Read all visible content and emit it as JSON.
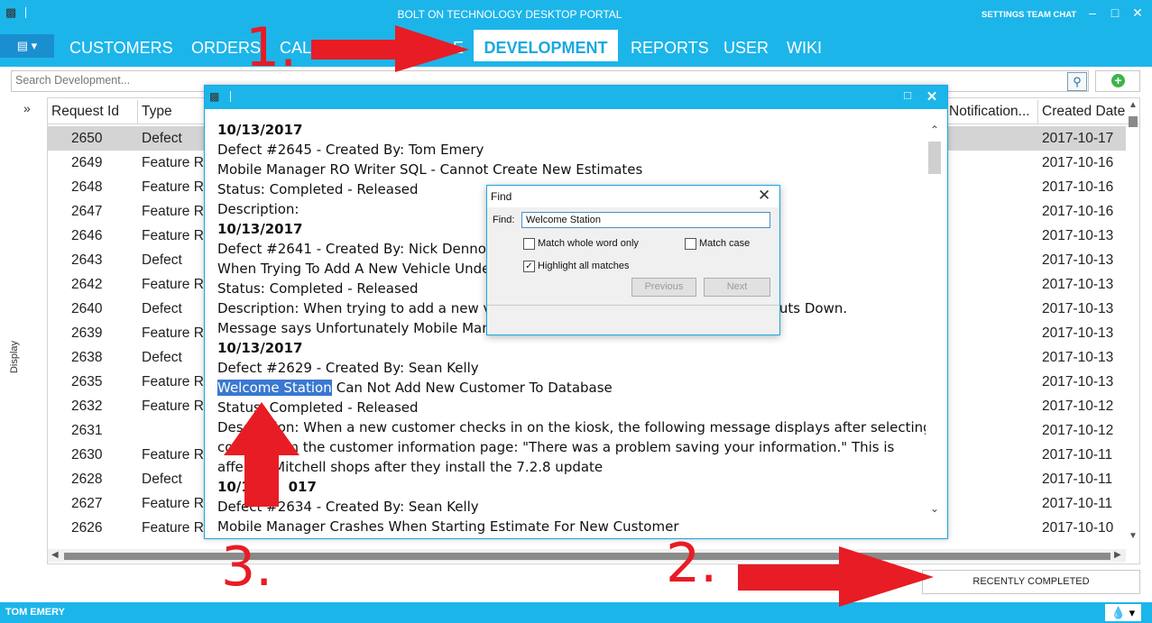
{
  "app": {
    "title": "BOLT ON TECHNOLOGY DESKTOP PORTAL",
    "settings": "SETTINGS",
    "team_chat": "TEAM CHAT"
  },
  "nav": {
    "tabs": [
      "CUSTOMERS",
      "ORDERS",
      "CAL",
      "DEVELOPMENT",
      "REPORTS",
      "USER",
      "WIKI"
    ],
    "tab_fragment_hidden": "E"
  },
  "search": {
    "placeholder": "Search Development..."
  },
  "side": {
    "label": "Display",
    "collapse": "»"
  },
  "grid": {
    "columns": [
      "Request Id",
      "Type",
      "Notification...",
      "Created Date"
    ],
    "rows": [
      {
        "id": "2650",
        "type": "Defect",
        "date": "2017-10-17"
      },
      {
        "id": "2649",
        "type": "Feature Re",
        "date": "2017-10-16"
      },
      {
        "id": "2648",
        "type": "Feature Re",
        "date": "2017-10-16"
      },
      {
        "id": "2647",
        "type": "Feature Re",
        "date": "2017-10-16"
      },
      {
        "id": "2646",
        "type": "Feature Re",
        "date": "2017-10-13"
      },
      {
        "id": "2643",
        "type": "Defect",
        "date": "2017-10-13"
      },
      {
        "id": "2642",
        "type": "Feature Re",
        "date": "2017-10-13"
      },
      {
        "id": "2640",
        "type": "Defect",
        "date": "2017-10-13"
      },
      {
        "id": "2639",
        "type": "Feature Re",
        "date": "2017-10-13"
      },
      {
        "id": "2638",
        "type": "Defect",
        "date": "2017-10-13"
      },
      {
        "id": "2635",
        "type": "Feature Re",
        "date": "2017-10-13"
      },
      {
        "id": "2632",
        "type": "Feature Re",
        "date": "2017-10-12"
      },
      {
        "id": "2631",
        "type": "",
        "date": "2017-10-12"
      },
      {
        "id": "2630",
        "type": "Feature Re",
        "date": "2017-10-11"
      },
      {
        "id": "2628",
        "type": "Defect",
        "date": "2017-10-11"
      },
      {
        "id": "2627",
        "type": "Feature Re",
        "date": "2017-10-11"
      },
      {
        "id": "2626",
        "type": "Feature Re",
        "date": "2017-10-10"
      }
    ]
  },
  "recently_completed": "RECENTLY COMPLETED",
  "status": {
    "user": "TOM EMERY"
  },
  "popup": {
    "lines": [
      {
        "text": "10/13/2017",
        "bold": true
      },
      {
        "text": "Defect #2645 - Created By: Tom Emery"
      },
      {
        "text": "Mobile Manager RO Writer SQL - Cannot Create New Estimates"
      },
      {
        "text": "Status: Completed - Released"
      },
      {
        "text": "Description:"
      },
      {
        "text": "10/13/2017",
        "bold": true
      },
      {
        "text": "Defect #2641 - Created By: Nick Denno"
      },
      {
        "text": "When Trying To Add A New Vehicle Unde                                                    uts Down."
      },
      {
        "text": "Status: Completed - Released"
      },
      {
        "text": "Description: When trying to add a new ve                                                 anager Shuts Down."
      },
      {
        "text": "Message says Unfortunately Mobile Mana"
      },
      {
        "text": "10/13/2017",
        "bold": true
      },
      {
        "text": "Defect #2629 - Created By: Sean Kelly"
      },
      {
        "text": "Can Not Add New Customer To Database",
        "highlight": "Welcome Station"
      },
      {
        "text": "Status: Completed - Released"
      },
      {
        "text": "Description: When a new customer checks in on the kiosk, the following message displays after selecting"
      },
      {
        "text": "co         rom the customer information page: \"There was a problem saving your information.\" This is"
      },
      {
        "text": "affe       Mitchell shops after they install the 7.2.8 update"
      },
      {
        "text": "10/1        017",
        "bold": true
      },
      {
        "text": "Defect #2634 - Created By: Sean Kelly"
      },
      {
        "text": "Mobile Manager Crashes When Starting Estimate For New Customer"
      }
    ]
  },
  "find": {
    "title": "Find",
    "label": "Find:",
    "value": "Welcome Station",
    "match_whole_word": "Match whole word only",
    "match_case": "Match case",
    "highlight_all": "Highlight all matches",
    "previous": "Previous",
    "next": "Next"
  },
  "annotations": {
    "one": "1.",
    "two": "2.",
    "three": "3.",
    "color": "#e81c24"
  }
}
